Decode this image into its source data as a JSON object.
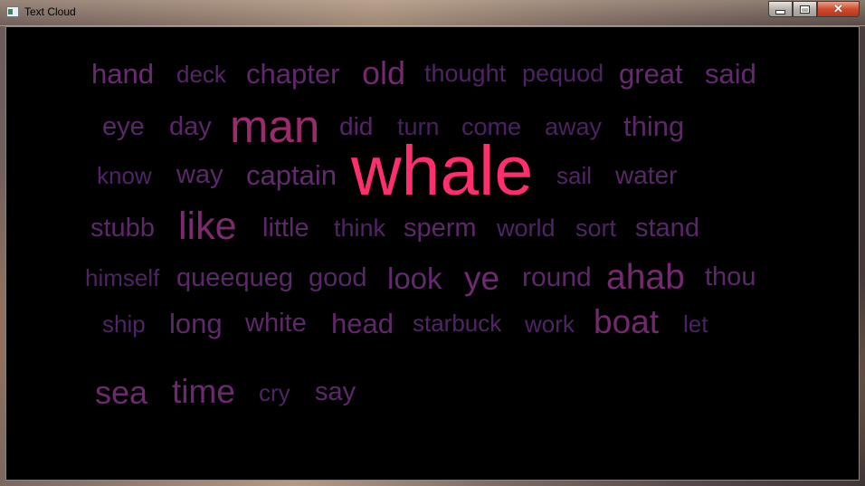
{
  "window": {
    "title": "Text Cloud",
    "buttons": {
      "minimize": "minimize",
      "maximize": "maximize",
      "close": "close"
    }
  },
  "cloud": {
    "words": [
      {
        "text": "hand",
        "color": "#6b2a73"
      },
      {
        "text": "deck",
        "color": "#552565"
      },
      {
        "text": "chapter",
        "color": "#62286f"
      },
      {
        "text": "old",
        "color": "#73296f"
      },
      {
        "text": "thought",
        "color": "#4e2463"
      },
      {
        "text": "pequod",
        "color": "#4d2462"
      },
      {
        "text": "great",
        "color": "#662a70"
      },
      {
        "text": "said",
        "color": "#62296f"
      },
      {
        "text": "eye",
        "color": "#5a2868"
      },
      {
        "text": "day",
        "color": "#592768"
      },
      {
        "text": "man",
        "color": "#9a2c6e"
      },
      {
        "text": "did",
        "color": "#552566"
      },
      {
        "text": "turn",
        "color": "#472160"
      },
      {
        "text": "come",
        "color": "#4a2261"
      },
      {
        "text": "away",
        "color": "#4a2261"
      },
      {
        "text": "thing",
        "color": "#5d2869"
      },
      {
        "text": "know",
        "color": "#502464"
      },
      {
        "text": "way",
        "color": "#5c2869"
      },
      {
        "text": "captain",
        "color": "#642a70"
      },
      {
        "text": "whale",
        "color": "#ff2f6e"
      },
      {
        "text": "sail",
        "color": "#512564"
      },
      {
        "text": "water",
        "color": "#582767"
      },
      {
        "text": "stubb",
        "color": "#5d2869"
      },
      {
        "text": "like",
        "color": "#7e2a70"
      },
      {
        "text": "little",
        "color": "#5b2868"
      },
      {
        "text": "think",
        "color": "#512564"
      },
      {
        "text": "sperm",
        "color": "#5d2869"
      },
      {
        "text": "world",
        "color": "#4e2463"
      },
      {
        "text": "sort",
        "color": "#4e2463"
      },
      {
        "text": "stand",
        "color": "#572767"
      },
      {
        "text": "himself",
        "color": "#4e2463"
      },
      {
        "text": "queequeg",
        "color": "#5d2869"
      },
      {
        "text": "good",
        "color": "#582767"
      },
      {
        "text": "look",
        "color": "#622a6e"
      },
      {
        "text": "ye",
        "color": "#71296f"
      },
      {
        "text": "round",
        "color": "#5d2869"
      },
      {
        "text": "ahab",
        "color": "#75296f"
      },
      {
        "text": "thou",
        "color": "#5c2869"
      },
      {
        "text": "ship",
        "color": "#4e2463"
      },
      {
        "text": "long",
        "color": "#5f2969"
      },
      {
        "text": "white",
        "color": "#5d2869"
      },
      {
        "text": "head",
        "color": "#5f2969"
      },
      {
        "text": "starbuck",
        "color": "#512564"
      },
      {
        "text": "work",
        "color": "#4e2463"
      },
      {
        "text": "boat",
        "color": "#74296f"
      },
      {
        "text": "let",
        "color": "#4a2261"
      },
      {
        "text": "sea",
        "color": "#6e296f"
      },
      {
        "text": "time",
        "color": "#6b2970"
      },
      {
        "text": "cry",
        "color": "#4e2463"
      },
      {
        "text": "say",
        "color": "#5d2869"
      }
    ]
  }
}
